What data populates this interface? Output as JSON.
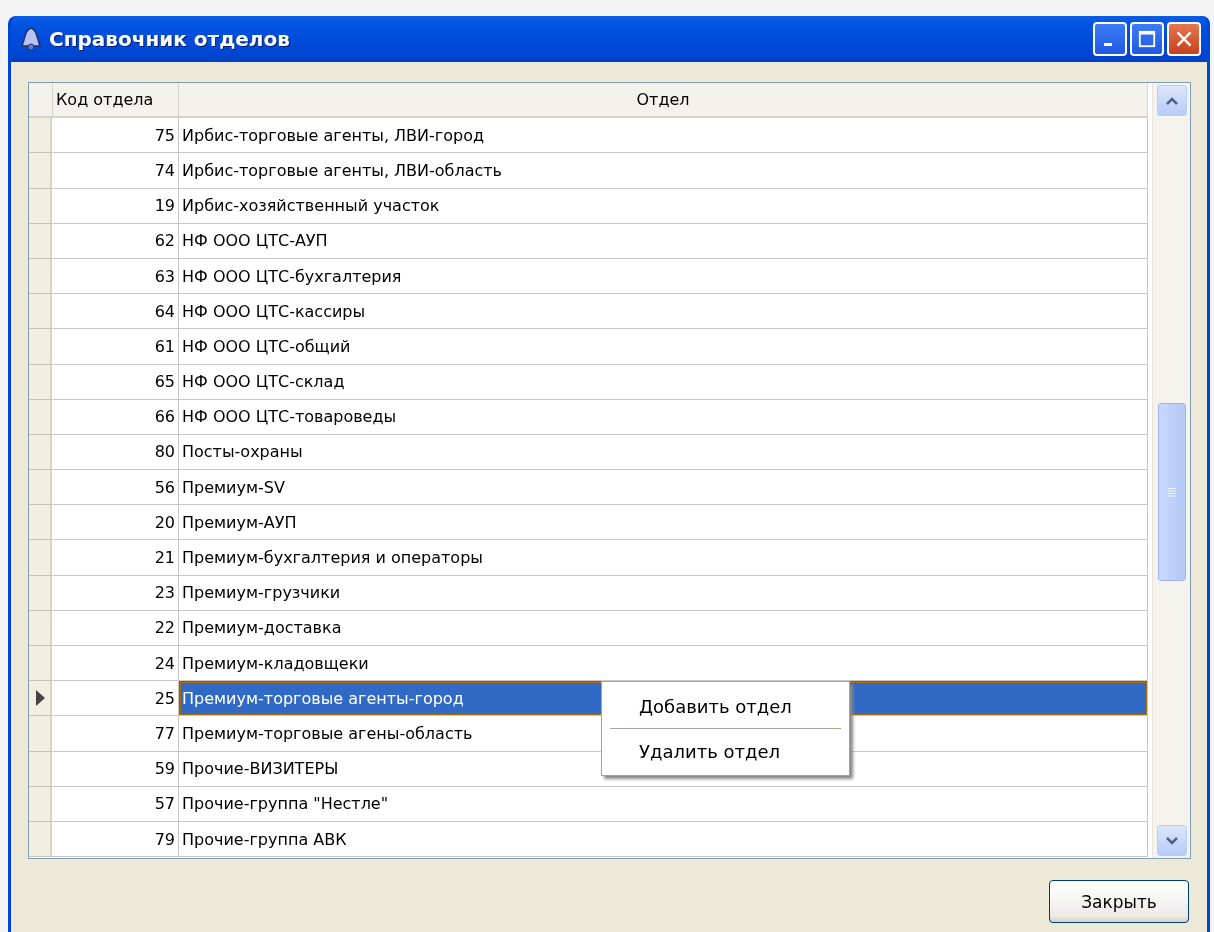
{
  "window": {
    "title": "Справочник отделов"
  },
  "table": {
    "columns": [
      "Код отдела",
      "Отдел"
    ],
    "rows": [
      {
        "code": "75",
        "name": "Ирбис-торговые агенты, ЛВИ-город",
        "selected": false
      },
      {
        "code": "74",
        "name": "Ирбис-торговые агенты, ЛВИ-область",
        "selected": false
      },
      {
        "code": "19",
        "name": "Ирбис-хозяйственный участок",
        "selected": false
      },
      {
        "code": "62",
        "name": "НФ ООО ЦТС-АУП",
        "selected": false
      },
      {
        "code": "63",
        "name": "НФ ООО ЦТС-бухгалтерия",
        "selected": false
      },
      {
        "code": "64",
        "name": "НФ ООО ЦТС-кассиры",
        "selected": false
      },
      {
        "code": "61",
        "name": "НФ ООО ЦТС-общий",
        "selected": false
      },
      {
        "code": "65",
        "name": "НФ ООО ЦТС-склад",
        "selected": false
      },
      {
        "code": "66",
        "name": "НФ ООО ЦТС-товароведы",
        "selected": false
      },
      {
        "code": "80",
        "name": "Посты-охраны",
        "selected": false
      },
      {
        "code": "56",
        "name": "Премиум-SV",
        "selected": false
      },
      {
        "code": "20",
        "name": "Премиум-АУП",
        "selected": false
      },
      {
        "code": "21",
        "name": "Премиум-бухгалтерия и операторы",
        "selected": false
      },
      {
        "code": "23",
        "name": "Премиум-грузчики",
        "selected": false
      },
      {
        "code": "22",
        "name": "Премиум-доставка",
        "selected": false
      },
      {
        "code": "24",
        "name": "Премиум-кладовщеки",
        "selected": false
      },
      {
        "code": "25",
        "name": "Премиум-торговые агенты-город",
        "selected": true
      },
      {
        "code": "77",
        "name": "Премиум-торговые агены-область",
        "selected": false
      },
      {
        "code": "59",
        "name": "Прочие-ВИЗИТЕРЫ",
        "selected": false
      },
      {
        "code": "57",
        "name": "Прочие-группа \"Нестле\"",
        "selected": false
      },
      {
        "code": "79",
        "name": "Прочие-группа АВК",
        "selected": false
      }
    ]
  },
  "context_menu": {
    "items": [
      "Добавить отдел",
      "Удалить отдел"
    ]
  },
  "buttons": [
    "Закрыть"
  ]
}
